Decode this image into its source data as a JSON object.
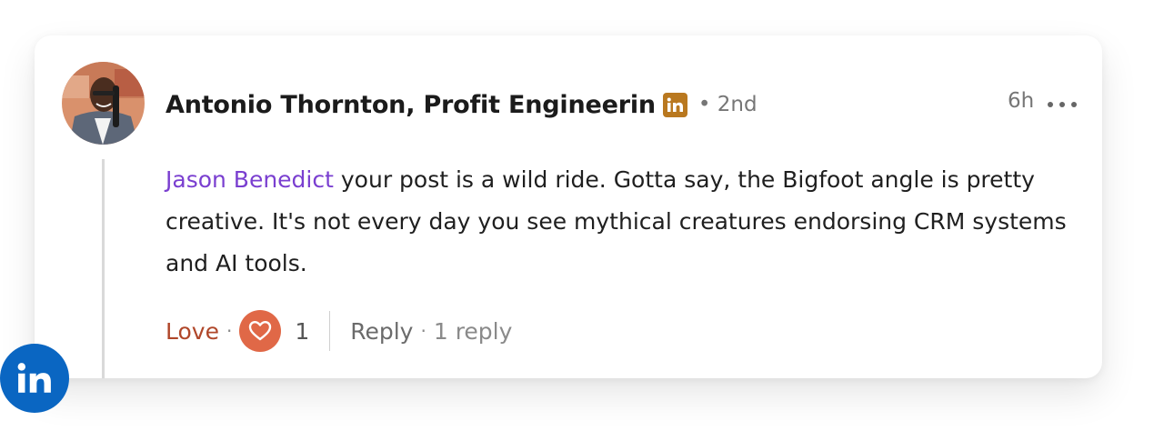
{
  "comment": {
    "author": "Antonio Thornton, Profit Engineerin",
    "author_badge_icon": "linkedin-icon",
    "degree": "• 2nd",
    "time": "6h",
    "mention": "Jason Benedict",
    "text": " your post is a wild ride. Gotta say, the Bigfoot angle is pretty creative. It's not every day you see mythical creatures endorsing CRM systems and AI tools."
  },
  "actions": {
    "love_label": "Love",
    "dot": "·",
    "reaction_count": "1",
    "reply_label": "Reply",
    "replies_count": "1 reply"
  },
  "colors": {
    "mention": "#7a3fd0",
    "love": "#b0472a",
    "heart_bg": "#e06847",
    "badge": "#b9781f",
    "linkedin_blue": "#0a66c2"
  },
  "brand_icon": "linkedin-logo-icon"
}
